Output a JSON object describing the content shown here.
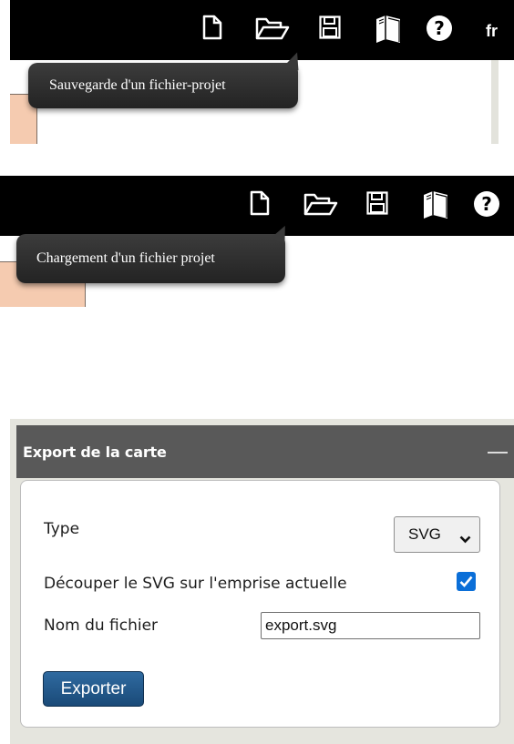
{
  "toolbar_icons": [
    "new-file-icon",
    "open-folder-icon",
    "save-icon",
    "manual-book-icon",
    "help-icon"
  ],
  "lang": "fr",
  "tooltip_save": "Sauvegarde d'un fichier-projet",
  "tooltip_load": "Chargement d'un fichier projet",
  "export_panel": {
    "title": "Export de la carte",
    "type_label": "Type",
    "type_value": "SVG",
    "clip_label": "Découper le SVG sur l'emprise actuelle",
    "clip_checked": true,
    "filename_label": "Nom du fichier",
    "filename_value": "export.svg",
    "export_button": "Exporter"
  },
  "colors": {
    "toolbar_bg": "#000000",
    "panel_header": "#595959",
    "button_blue": "#1f5585",
    "checkbox_blue": "#0b6fd8",
    "orange_fill": "#f5cbb0"
  }
}
